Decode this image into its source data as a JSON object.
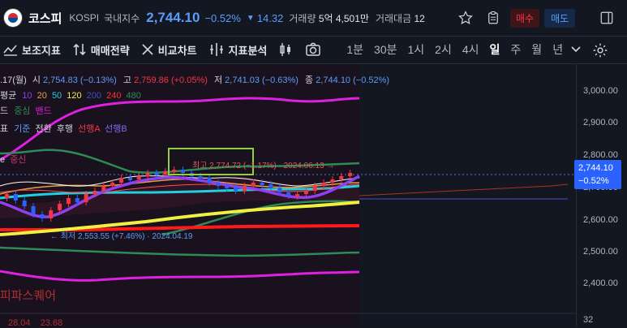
{
  "header": {
    "name": "코스피",
    "code": "KOSPI",
    "type": "국내지수",
    "price": "2,744.10",
    "change_pct": "−0.52%",
    "change_abs": "14.32",
    "volume_label": "거래량",
    "volume_value": "5억 4,501만",
    "amount_label": "거래대금",
    "amount_value": "12",
    "buy_label": "매수",
    "sell_label": "매도"
  },
  "toolbar": {
    "indicators": "보조지표",
    "strategy": "매매전략",
    "compare": "비교차트",
    "analysis": "지표분석",
    "timeframes": [
      "1분",
      "30분",
      "1시",
      "2시",
      "4시",
      "일",
      "주",
      "월",
      "년"
    ],
    "active_tf": "일"
  },
  "legend": {
    "ohlc": {
      "date": ".17(월)",
      "o_label": "시",
      "o": "2,754.83 (−0.13%)",
      "h_label": "고",
      "h": "2,759.86 (+0.05%)",
      "l_label": "저",
      "l": "2,741.03 (−0.63%)",
      "c_label": "종",
      "c": "2,744.10 (−0.52%)"
    },
    "ma": {
      "label": "평균",
      "p10": "10",
      "p20": "20",
      "p50": "50",
      "p120": "120",
      "p200": "200",
      "p240": "240",
      "p480": "480"
    },
    "bb": {
      "label": "드",
      "middle": "중심",
      "band": "밴드"
    },
    "ichimoku": {
      "label": "표",
      "base": "기준",
      "conv": "전환",
      "lag": "후행",
      "spanA": "선행A",
      "spanB": "선행B"
    },
    "e_label": "e",
    "e_sub": "중신"
  },
  "annotations": {
    "high": "최고 2,774.72 (−1.17%) · 2024.06.13 →",
    "low": "← 최저 2,553.55 (+7.46%) · 2024.04.19",
    "bottom_left": "피파스퀘어",
    "bottom_nums": "28.04    23.68"
  },
  "axis": {
    "ticks": [
      "3,000.00",
      "2,900.00",
      "2,800.00",
      "2,700.00",
      "2,600.00",
      "2,500.00",
      "2,400.00",
      "32"
    ],
    "tag_price": "2,744.10",
    "tag_pct": "−0.52%"
  },
  "colors": {
    "up": "#f23645",
    "down": "#2962ff",
    "accent": "#5b9cf6",
    "bg": "#131722"
  }
}
